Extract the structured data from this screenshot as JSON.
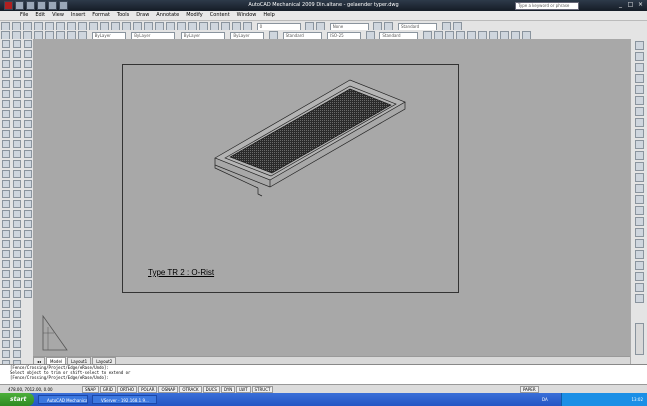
{
  "window": {
    "title": "AutoCAD Mechanical 2009  Din.altane - gelaender typer.dwg",
    "search_placeholder": "Type a keyword or phrase"
  },
  "menu": [
    "File",
    "Edit",
    "View",
    "Insert",
    "Format",
    "Tools",
    "Draw",
    "Annotate",
    "Modify",
    "Content",
    "Window",
    "Help"
  ],
  "toolbar": {
    "layer_combo": "0",
    "bylayer_1": "ByLayer",
    "bylayer_2": "ByLayer",
    "bylayer_3": "ByLayer",
    "color_combo": "ByLayer",
    "text_style": "Standard",
    "dim_style": "ISO-25",
    "table_style": "Standard",
    "mleader_style": "Standard",
    "visual_style": "None"
  },
  "drawing": {
    "label": "Type TR 2 : O-Rist"
  },
  "tabs": [
    "Model",
    "Layout1",
    "Layout2"
  ],
  "command_lines": [
    "[Fence/Crossing/Project/Edge/eRase/Undo]:",
    "Select object to trim or shift-select to extend or",
    "[Fence/Crossing/Project/Edge/eRase/Undo]:"
  ],
  "status": {
    "coords": "478.00, 7012.00, 0.00",
    "modes": [
      "SNAP",
      "GRID",
      "ORTHO",
      "POLAR",
      "OSNAP",
      "OTRACK",
      "DUCS",
      "DYN",
      "LWT"
    ],
    "struct_label": "STRUCT",
    "paper_label": "PAPER"
  },
  "taskbar": {
    "start_label": "start",
    "tasks": [
      "AutoCAD Mechanical ...",
      "VServer - 192.168.1.9..."
    ],
    "language": "DA",
    "clock": "13:02"
  },
  "colors": {
    "canvas": "#a8a8a8",
    "taskbar": "#2355c4",
    "start": "#3c9a2c",
    "titlebar": "#1d2633"
  }
}
